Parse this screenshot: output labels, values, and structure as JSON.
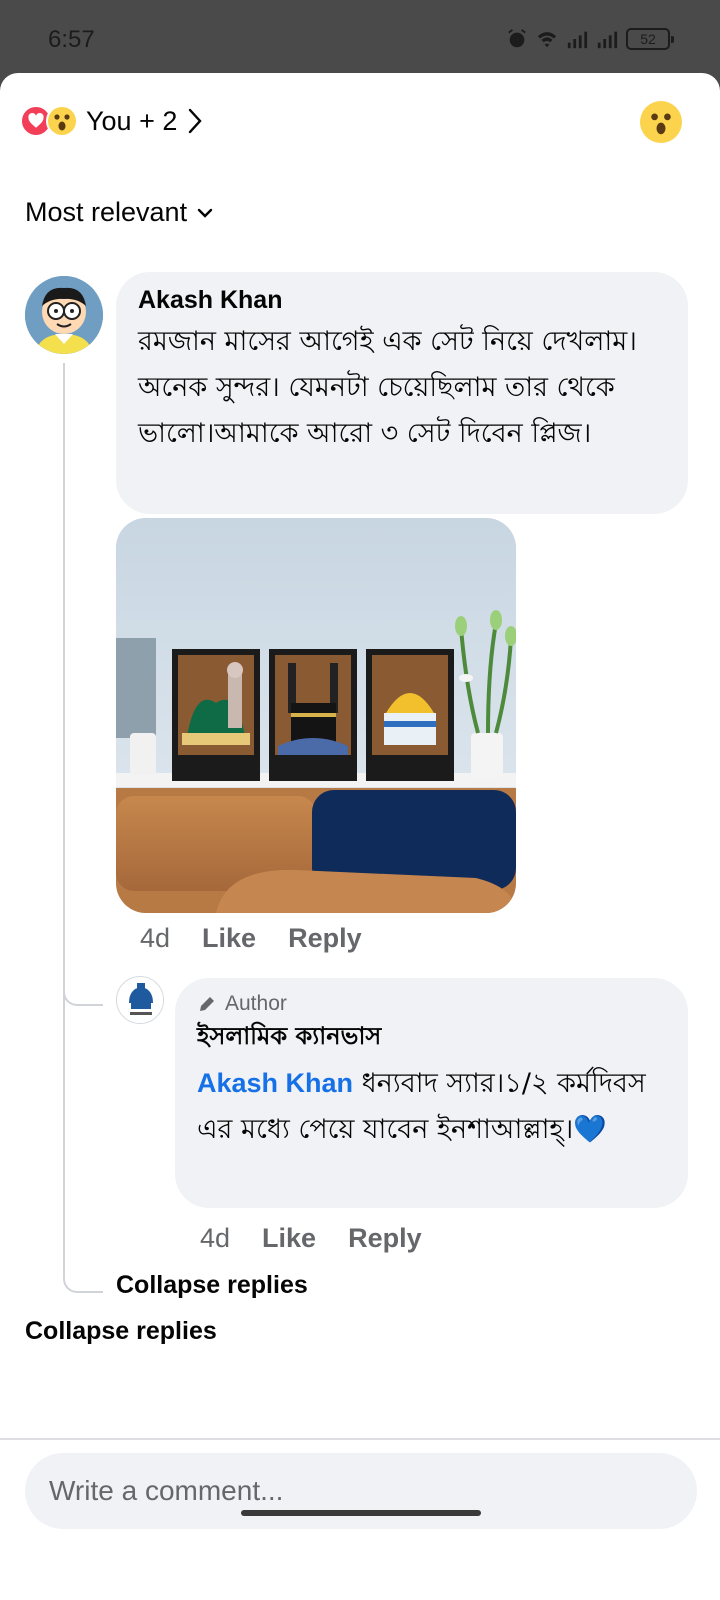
{
  "status": {
    "time": "6:57",
    "battery": "52"
  },
  "reactions": {
    "summary": "You + 2",
    "icons": [
      "heart-icon",
      "wow-icon"
    ]
  },
  "sort": {
    "label": "Most relevant"
  },
  "comment": {
    "author": "Akash Khan",
    "text": "রমজান মাসের আগেই এক সেট নিয়ে দেখলাম।অনেক সুন্দর। যেমনটা চেয়েছিলাম তার থেকে ভালো।আমাকে আরো ৩ সেট দিবেন প্লিজ।",
    "time": "4d",
    "like": "Like",
    "reply": "Reply"
  },
  "reply": {
    "badge": "Author",
    "page_name": "ইসলামিক ক্যানভাস",
    "mention": "Akash Khan",
    "text": " ধন্যবাদ স্যার।১/২ কর্মদিবস এর মধ্যে পেয়ে যাবেন ইনশাআল্লাহ্।💙",
    "time": "4d",
    "like": "Like",
    "reply": "Reply"
  },
  "collapse_replies_nested": "Collapse replies",
  "collapse_replies": "Collapse replies",
  "composer": {
    "placeholder": "Write a comment..."
  },
  "colors": {
    "link": "#1771e6",
    "bubble": "#f0f2f5",
    "heart": "#f33e58",
    "wow": "#fcd34d"
  }
}
